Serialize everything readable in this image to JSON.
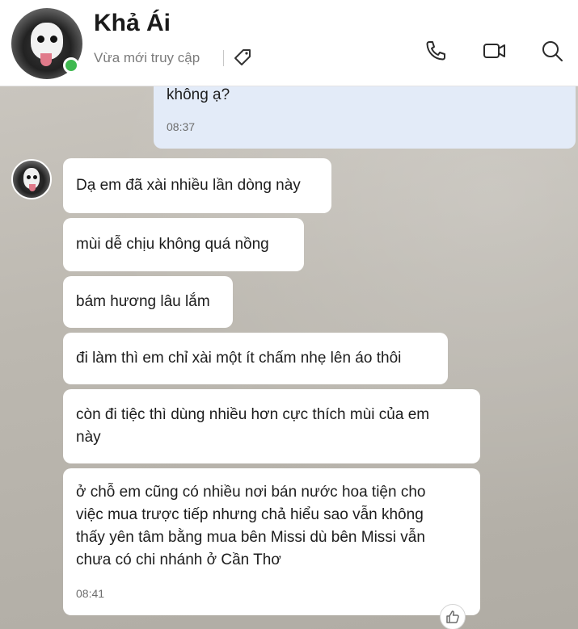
{
  "header": {
    "contact_name": "Khả Ái",
    "status": "Vừa mới truy cập",
    "icons": {
      "tag": "tag-icon",
      "call": "phone-icon",
      "video": "video-camera-icon",
      "search": "search-icon"
    },
    "online_color": "#3fb950"
  },
  "messages": [
    {
      "direction": "outgoing",
      "text": "không ạ?",
      "time": "08:37"
    },
    {
      "direction": "incoming",
      "text": "Dạ em đã xài nhiều lần dòng này"
    },
    {
      "direction": "incoming",
      "text": "mùi dễ chịu không quá nồng"
    },
    {
      "direction": "incoming",
      "text": "bám hương lâu lắm"
    },
    {
      "direction": "incoming",
      "text": "đi làm thì em chỉ xài một ít chấm nhẹ lên áo thôi"
    },
    {
      "direction": "incoming",
      "lines": [
        "còn đi tiệc thì dùng nhiều hơn cực thích mùi của em",
        "này"
      ]
    },
    {
      "direction": "incoming",
      "lines": [
        "ở chỗ em cũng có nhiều nơi bán nước hoa tiện cho",
        "việc mua trược tiếp nhưng chả hiểu sao vẫn không",
        "thấy yên tâm bằng mua bên Missi dù bên Missi vẫn",
        "chưa có chi nhánh ở Cần Thơ"
      ],
      "time": "08:41",
      "reaction_icon": "thumbs-up-icon"
    }
  ],
  "colors": {
    "outgoing_bubble": "#e3ebf8",
    "incoming_bubble": "#ffffff"
  }
}
